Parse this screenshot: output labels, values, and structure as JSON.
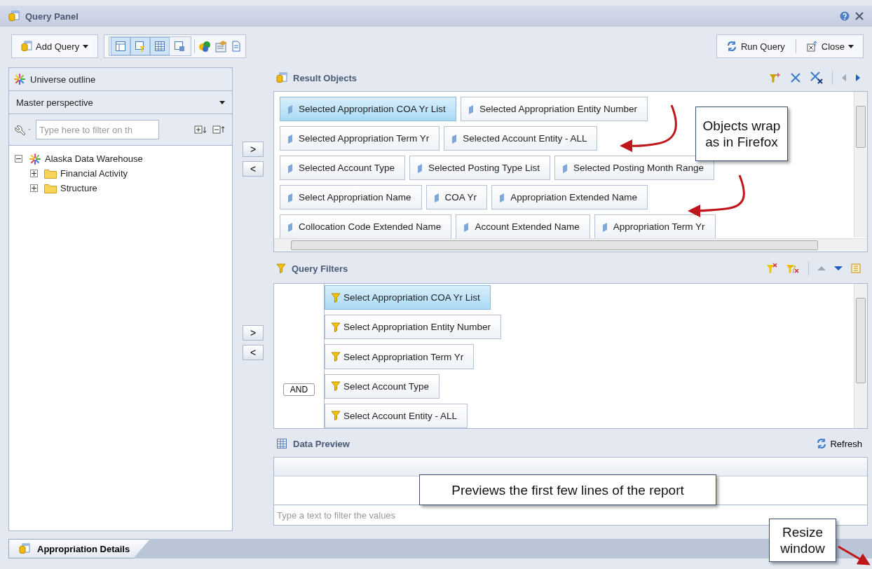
{
  "window": {
    "title": "Query Panel"
  },
  "toolbar": {
    "add_query": "Add Query",
    "move_buttons": [
      ">",
      "<",
      ">",
      "<"
    ],
    "view_buttons": [
      {
        "kind": "outline",
        "selected": true
      },
      {
        "kind": "filter",
        "selected": true
      },
      {
        "kind": "grid",
        "selected": true
      },
      {
        "kind": "preview",
        "selected": false
      }
    ],
    "run_query": "Run Query",
    "close": "Close"
  },
  "universe_outline": {
    "title": "Universe outline",
    "perspective": "Master perspective",
    "filter_placeholder": "Type here to filter on th",
    "tree": [
      {
        "label": "Alaska Data Warehouse",
        "kind": "universe",
        "expanded": true,
        "children": [
          {
            "label": "Financial Activity",
            "kind": "folder",
            "expanded": false
          },
          {
            "label": "Structure",
            "kind": "folder",
            "expanded": false
          }
        ]
      }
    ]
  },
  "result_objects": {
    "title": "Result Objects",
    "rows": [
      {
        "items": [
          {
            "label": "Selected Appropriation COA Yr List",
            "selected": true
          },
          {
            "label": "Selected Appropriation Entity Number",
            "selected": false
          }
        ]
      },
      {
        "items": [
          {
            "label": "Selected Appropriation Term Yr",
            "selected": false
          },
          {
            "label": "Selected Account Entity - ALL",
            "selected": false
          }
        ]
      },
      {
        "items": [
          {
            "label": "Selected Account Type",
            "selected": false
          },
          {
            "label": "Selected Posting Type List",
            "selected": false
          },
          {
            "label": "Selected Posting Month Range",
            "selected": false
          }
        ]
      },
      {
        "items": [
          {
            "label": "Select Appropriation Name",
            "selected": false
          },
          {
            "label": "COA Yr",
            "selected": false
          },
          {
            "label": "Appropriation Extended Name",
            "selected": false
          }
        ]
      },
      {
        "items": [
          {
            "label": "Collocation Code Extended Name",
            "selected": false
          },
          {
            "label": "Account Extended Name",
            "selected": false
          },
          {
            "label": "Appropriation Term Yr",
            "selected": false
          }
        ]
      }
    ]
  },
  "query_filters": {
    "title": "Query Filters",
    "operator": "AND",
    "items": [
      {
        "label": "Select Appropriation COA Yr List",
        "selected": true
      },
      {
        "label": "Select Appropriation Entity Number",
        "selected": false
      },
      {
        "label": "Select Appropriation Term Yr",
        "selected": false
      },
      {
        "label": "Select Account Type",
        "selected": false
      },
      {
        "label": "Select Account Entity - ALL",
        "selected": false
      }
    ]
  },
  "data_preview": {
    "title": "Data Preview",
    "refresh": "Refresh",
    "filter_placeholder": "Type a text to filter the values"
  },
  "tabs": [
    {
      "label": "Appropriation Details",
      "selected": true
    }
  ],
  "callouts": [
    {
      "kind": "wrap",
      "text": "Objects wrap as in Firefox"
    },
    {
      "kind": "preview",
      "text": "Previews the first few lines of the report"
    },
    {
      "kind": "resize",
      "text": "Resize window"
    }
  ]
}
